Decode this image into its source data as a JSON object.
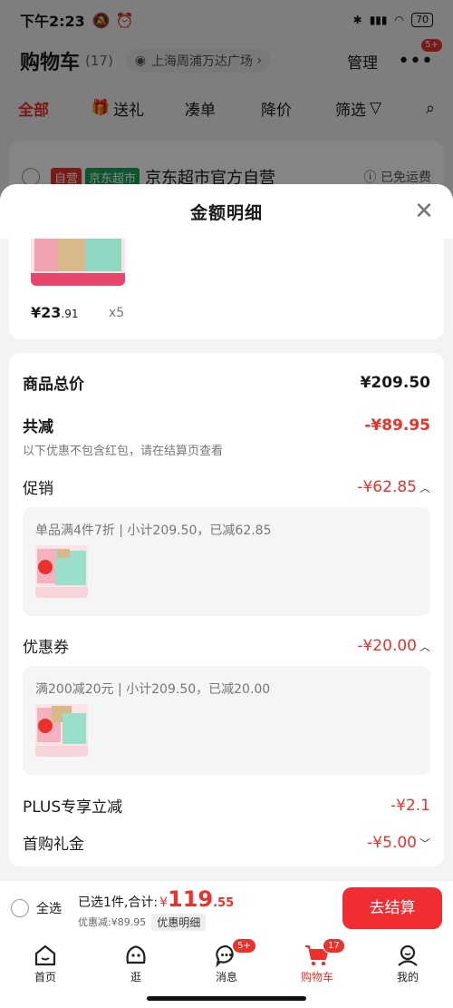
{
  "status_bar": {
    "time": "下午2:23",
    "battery": "70"
  },
  "cart_header": {
    "title": "购物车",
    "count": "(17)",
    "address": "上海周浦万达广场",
    "manage": "管理",
    "more_badge": "5+"
  },
  "tabs": {
    "all": "全部",
    "gift": "送礼",
    "combo": "凑单",
    "price_drop": "降价",
    "filter": "筛选"
  },
  "store": {
    "tag_self": "自营",
    "tag_jd": "京东超市",
    "name": "京东超市官方自营",
    "free_shipping": "已免运费"
  },
  "sheet": {
    "title": "金额明细",
    "product": {
      "price_int": "¥23",
      "price_dec": ".91",
      "qty": "x5"
    },
    "total_label": "商品总价",
    "total_value": "¥209.50",
    "reduce_label": "共减",
    "reduce_value": "-¥89.95",
    "reduce_note": "以下优惠不包含红包，请在结算页查看",
    "promo_label": "促销",
    "promo_value": "-¥62.85",
    "promo_desc": "单品满4件7折 | 小计209.50，已减62.85",
    "coupon_label": "优惠券",
    "coupon_value": "-¥20.00",
    "coupon_desc": "满200减20元 | 小计209.50，已减20.00",
    "plus_label": "PLUS专享立减",
    "plus_value": "-¥2.1",
    "gift_label": "首购礼金",
    "gift_value": "-¥5.00"
  },
  "checkout": {
    "select_all": "全选",
    "selected_text": "已选1件,合计:",
    "currency": "¥",
    "total_int": "119",
    "total_dec": ".55",
    "discount_text": "优惠减:¥89.95",
    "detail_chip": "优惠明细",
    "button": "去结算"
  },
  "nav": [
    {
      "label": "首页",
      "icon": "home-icon"
    },
    {
      "label": "逛",
      "icon": "browse-icon"
    },
    {
      "label": "消息",
      "icon": "message-icon",
      "badge": "5+"
    },
    {
      "label": "购物车",
      "icon": "cart-icon",
      "badge": "17"
    },
    {
      "label": "我的",
      "icon": "profile-icon"
    }
  ],
  "colors": {
    "accent": "#e8322b",
    "checkout_button": "#ef2d33",
    "jd_green": "#1aa35a"
  }
}
